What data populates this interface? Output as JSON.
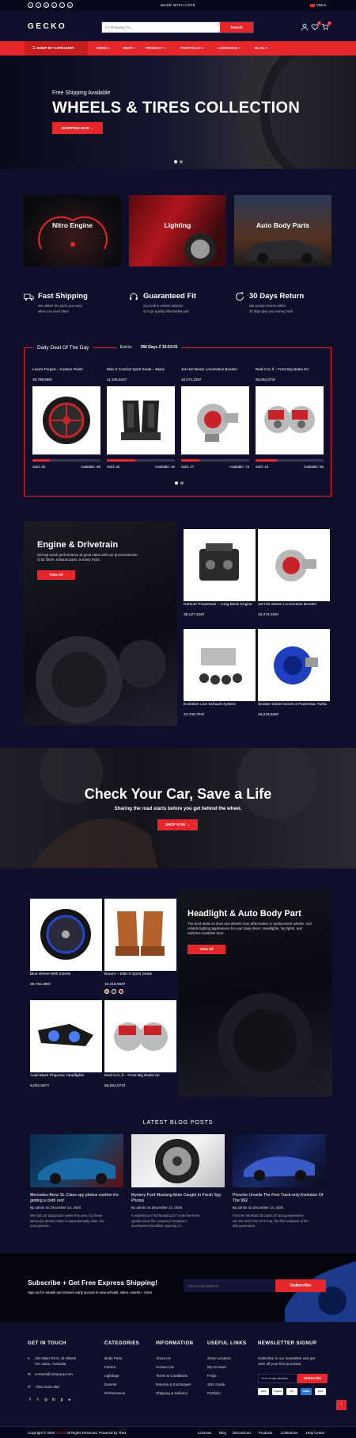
{
  "topbar": {
    "social_icons": [
      "facebook-icon",
      "twitter-icon",
      "instagram-icon",
      "pinterest-icon",
      "tiktok-icon",
      "youtube-icon"
    ],
    "message": "MADE WITH LOVE",
    "language": "VND"
  },
  "header": {
    "logo": "GECKO",
    "search_placeholder": "I'm shopping for...",
    "search_button": "Search",
    "wishlist_count": "0",
    "cart_count": "0"
  },
  "nav": {
    "category_button": "SHOP BY CATEGORY",
    "items": [
      "DEMO",
      "SHOP",
      "PRODUCT",
      "PORTFOLIO",
      "LOOKBOOK",
      "BLOG"
    ]
  },
  "hero": {
    "subtitle": "Free Shipping Available",
    "title": "WHEELS & TIRES COLLECTION",
    "button": "SHOPPING NOW"
  },
  "categories": [
    {
      "label": "Nitro Engine"
    },
    {
      "label": "Lighting"
    },
    {
      "label": "Auto Body Parts"
    }
  ],
  "features": [
    {
      "title": "Fast Shipping",
      "desc1": "We deliver the parts you need",
      "desc2": "when you need them"
    },
    {
      "title": "Guaranteed Fit",
      "desc1": "Our built in vehicle selector",
      "desc2": "of in go quality aftermarket part"
    },
    {
      "title": "30 Days Return",
      "desc1": "We accept returns within",
      "desc2": "30 days give you money back"
    }
  ],
  "deal": {
    "heading": "Daily Deal Of The Day",
    "end_label": "End in:",
    "countdown": "356 Days 2 15:53:01",
    "products": [
      {
        "name": "Lexani Forged – Custom Finish",
        "price": "29,798,556₫",
        "sold": "Sold: 33",
        "available": "Available: 96",
        "progress": 0.26
      },
      {
        "name": "Elite-X Comfort Sport Seats – Black",
        "price": "11,105,844₫",
        "sold": "Sold: 35",
        "available": "Available: 48",
        "progress": 0.42
      },
      {
        "name": "Jet-Hot Steam Locomotive Booster",
        "price": "10,374,225₫",
        "sold": "Sold: 27",
        "available": "Available: 73",
        "progress": 0.27
      },
      {
        "name": "Redi-CAL ll – Front Big Brake Kit",
        "price": "68,052,073₫",
        "sold": "Sold: 44",
        "available": "Available: 96",
        "progress": 0.31
      }
    ]
  },
  "engine": {
    "title": "Engine & Drivetrain",
    "desc": "Get top notch performance at great value with our great selection of air filters, exhaust parts, & many more.",
    "button": "View All",
    "products": [
      {
        "name": "Dahmer Powertrain – Long Block Engine",
        "price": "38,127,316₫"
      },
      {
        "name": "Jet-Hot Steam Locomotive Booster",
        "price": "10,374,225₫"
      },
      {
        "name": "Evolution Line Exhaust System",
        "price": "24,708,704₫"
      },
      {
        "name": "Sinister Diesel Series 3 Powermax Turbo",
        "price": "46,016,538₫"
      }
    ]
  },
  "cta": {
    "title": "Check Your Car, Save a Life",
    "desc": "Sharing the road starts before you get behind the wheel.",
    "button": "SHOP NOW"
  },
  "headlight": {
    "title": "Headlight & Auto Body Part",
    "desc": "The best deals on lines and wheels from aftermarket or replacement wheels. Get reliable lighting applications for your daily driver. Headlights, fog lights, and switches available here.",
    "button": "View All",
    "products": [
      {
        "name": "Blue Wheel With Inserts",
        "price": "29,792,386₫"
      },
      {
        "name": "Braum – Elite-X Sport Seats",
        "price": "10,319,960₫"
      },
      {
        "name": "Axial Black Projector Headlights",
        "price": "8,002,667₫"
      },
      {
        "name": "Redi-CAL ll – Front Big Brake Kit",
        "price": "68,052,073₫"
      }
    ]
  },
  "blog": {
    "title": "LATEST BLOG POSTS",
    "posts": [
      {
        "title": "Mercedes-Benz SL-Class spy photos confirm it's getting a cloth roof",
        "meta": "By admin on December 14, 2020",
        "excerpt1": "We had our suspicions earlier this year, but these",
        "excerpt2": "latest spy photos make it unquestionably clear: the",
        "excerpt3": "next-generat..."
      },
      {
        "title": "Mystery Ford Mustang Mule Caught In Fresh Spy Photos",
        "meta": "By admin on December 14, 2020",
        "excerpt1": "A mysterious Ford Mustang GT mule has been",
        "excerpt2": "spotted near the company's Dearborn",
        "excerpt3": "development facilities, sporting a f..."
      },
      {
        "title": "Porsche Unveils The First Track-only Evolution Of The 992",
        "meta": "By admin on December 14, 2020",
        "excerpt1": "Porsche furnished decades of racing experience",
        "excerpt2": "into the 2021 911 GT3 Cup, the first evolution of the",
        "excerpt3": "992 generation..."
      }
    ]
  },
  "newsletter": {
    "title": "Subscribe + Get Free Express Shipping!",
    "desc": "Sign up for emails and receive early access to new arrivals, sales, events + more",
    "placeholder": "Your email address",
    "button": "Subscribe"
  },
  "footer": {
    "get_in_touch": "GET IN TOUCH",
    "address1": "184 Main Rd E, St Albans",
    "address2": "VIC 3021, Australia",
    "email": "contact@company.com",
    "phone": "+001 2233 456",
    "categories_title": "CATEGORIES",
    "categories": [
      "Body Parts",
      "Interior",
      "Lightings",
      "Exterior",
      "Performance"
    ],
    "information_title": "INFORMATION",
    "information": [
      "About Us",
      "Contact Us",
      "Terms & Conditions",
      "Returns & Exchanges",
      "Shipping & Delivery"
    ],
    "useful_title": "USEFUL LINKS",
    "useful": [
      "Store Location",
      "My Account",
      "FAQs",
      "Size Guide",
      "Portfolio"
    ],
    "newsletter_title": "NEWSLETTER SIGNUP",
    "newsletter_desc1": "Subscribe to our newsletter and get",
    "newsletter_desc2": "10% off your first purchase",
    "newsletter_placeholder": "Your email address",
    "newsletter_button": "Subscribe",
    "payments": [
      "VISA",
      "PayPal",
      "MC",
      "AMEX",
      "VISA"
    ],
    "copyright_prefix": "Copyright © 2020",
    "copyright_brand": "Gecko",
    "copyright_suffix": "All Rights Reserved. Powered by The4",
    "bottom_links": [
      "Licenses",
      "Blog",
      "Discussions",
      "Products",
      "Collections",
      "Help Center"
    ]
  }
}
